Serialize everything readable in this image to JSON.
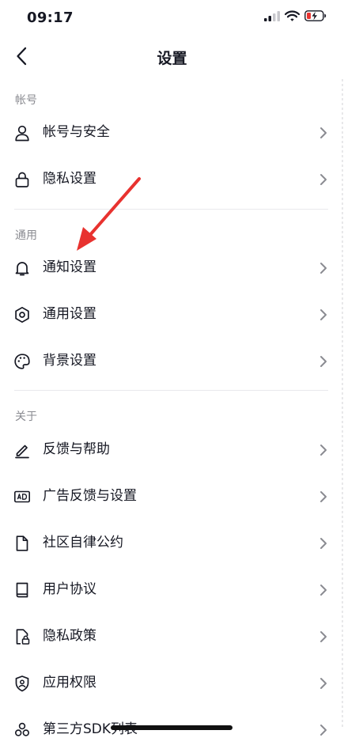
{
  "status_bar": {
    "time": "09:17"
  },
  "nav": {
    "title": "设置"
  },
  "sections": {
    "account": {
      "label": "帐号"
    },
    "general": {
      "label": "通用"
    },
    "about": {
      "label": "关于"
    }
  },
  "items": {
    "account_security": "帐号与安全",
    "privacy_settings": "隐私设置",
    "notification_settings": "通知设置",
    "general_settings": "通用设置",
    "background_settings": "背景设置",
    "feedback_help": "反馈与帮助",
    "ad_feedback": "广告反馈与设置",
    "community_rules": "社区自律公约",
    "user_agreement": "用户协议",
    "privacy_policy": "隐私政策",
    "app_permissions": "应用权限",
    "third_party_sdk": "第三方SDK列表"
  },
  "icons": {
    "account_security": "user-icon",
    "privacy_settings": "lock-icon",
    "notification_settings": "bell-icon",
    "general_settings": "gear-icon",
    "background_settings": "palette-icon",
    "feedback_help": "pencil-icon",
    "ad_feedback": "ad-icon",
    "community_rules": "document-icon",
    "user_agreement": "book-icon",
    "privacy_policy": "locked-document-icon",
    "app_permissions": "shield-icon",
    "third_party_sdk": "cubes-icon"
  },
  "colors": {
    "annotation_arrow": "#e8322f",
    "text": "#161823",
    "secondary_text": "#8a8b91"
  }
}
